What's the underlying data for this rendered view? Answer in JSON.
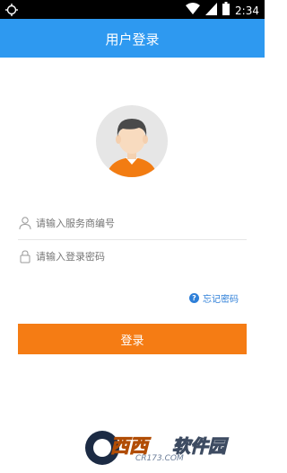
{
  "status_bar": {
    "time": "2:34"
  },
  "header": {
    "title": "用户登录"
  },
  "form": {
    "service_id_placeholder": "请输入服务商编号",
    "password_placeholder": "请输入登录密码",
    "forgot_password": "忘记密码",
    "login_button": "登录"
  },
  "watermark": {
    "brand": "西西",
    "site": "软件园",
    "url": "CR173.COM"
  },
  "colors": {
    "primary": "#2e99f0",
    "accent": "#f57c14",
    "link": "#2e7fd8"
  }
}
